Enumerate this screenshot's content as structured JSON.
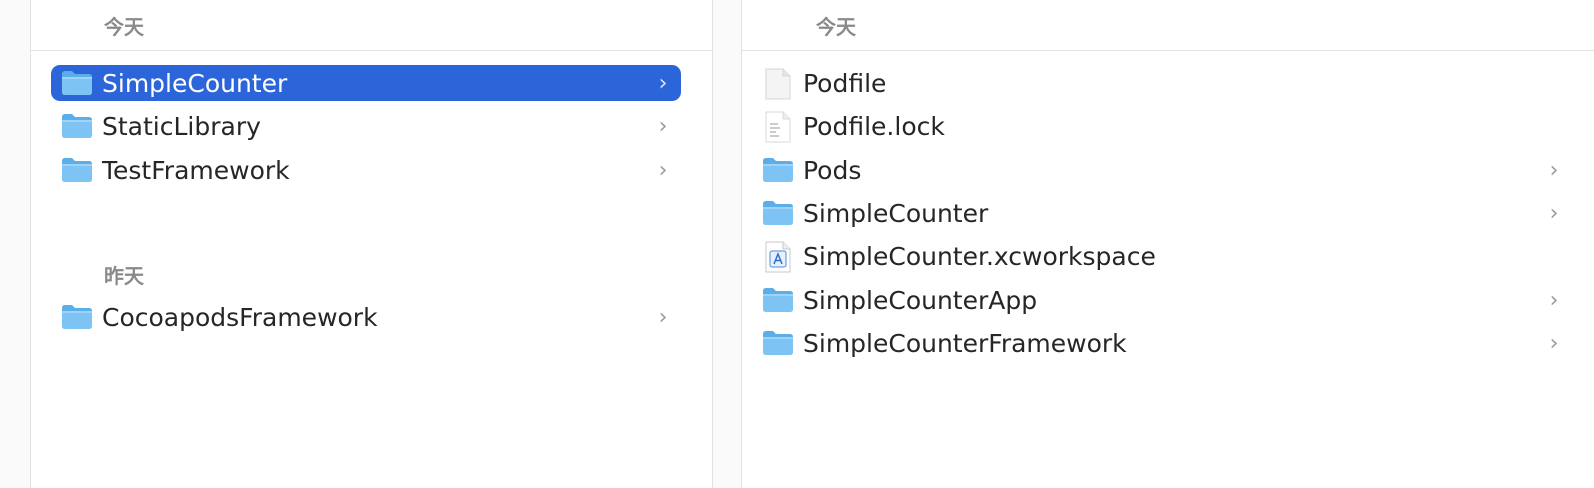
{
  "left_pane": {
    "sections": [
      {
        "label": "今天",
        "items": [
          {
            "name": "SimpleCounter",
            "icon": "folder-icon",
            "selected": true,
            "has_children": true
          },
          {
            "name": "StaticLibrary",
            "icon": "folder-icon",
            "selected": false,
            "has_children": true
          },
          {
            "name": "TestFramework",
            "icon": "folder-icon",
            "selected": false,
            "has_children": true
          }
        ]
      },
      {
        "label": "昨天",
        "items": [
          {
            "name": "CocoapodsFramework",
            "icon": "folder-icon",
            "selected": false,
            "has_children": true
          }
        ]
      }
    ]
  },
  "right_pane": {
    "section_label": "今天",
    "items": [
      {
        "name": "Podfile",
        "icon": "document-icon",
        "has_children": false
      },
      {
        "name": "Podfile.lock",
        "icon": "text-document-icon",
        "has_children": false
      },
      {
        "name": "Pods",
        "icon": "folder-icon",
        "has_children": true
      },
      {
        "name": "SimpleCounter",
        "icon": "folder-icon",
        "has_children": true
      },
      {
        "name": "SimpleCounter.xcworkspace",
        "icon": "xcworkspace-icon",
        "has_children": false
      },
      {
        "name": "SimpleCounterApp",
        "icon": "folder-icon",
        "has_children": true
      },
      {
        "name": "SimpleCounterFramework",
        "icon": "folder-icon",
        "has_children": true
      }
    ]
  },
  "chevron_glyph": "›",
  "colors": {
    "selection": "#2c64d9",
    "folder_body": "#7dc3f3",
    "folder_tab": "#5aaee9"
  }
}
